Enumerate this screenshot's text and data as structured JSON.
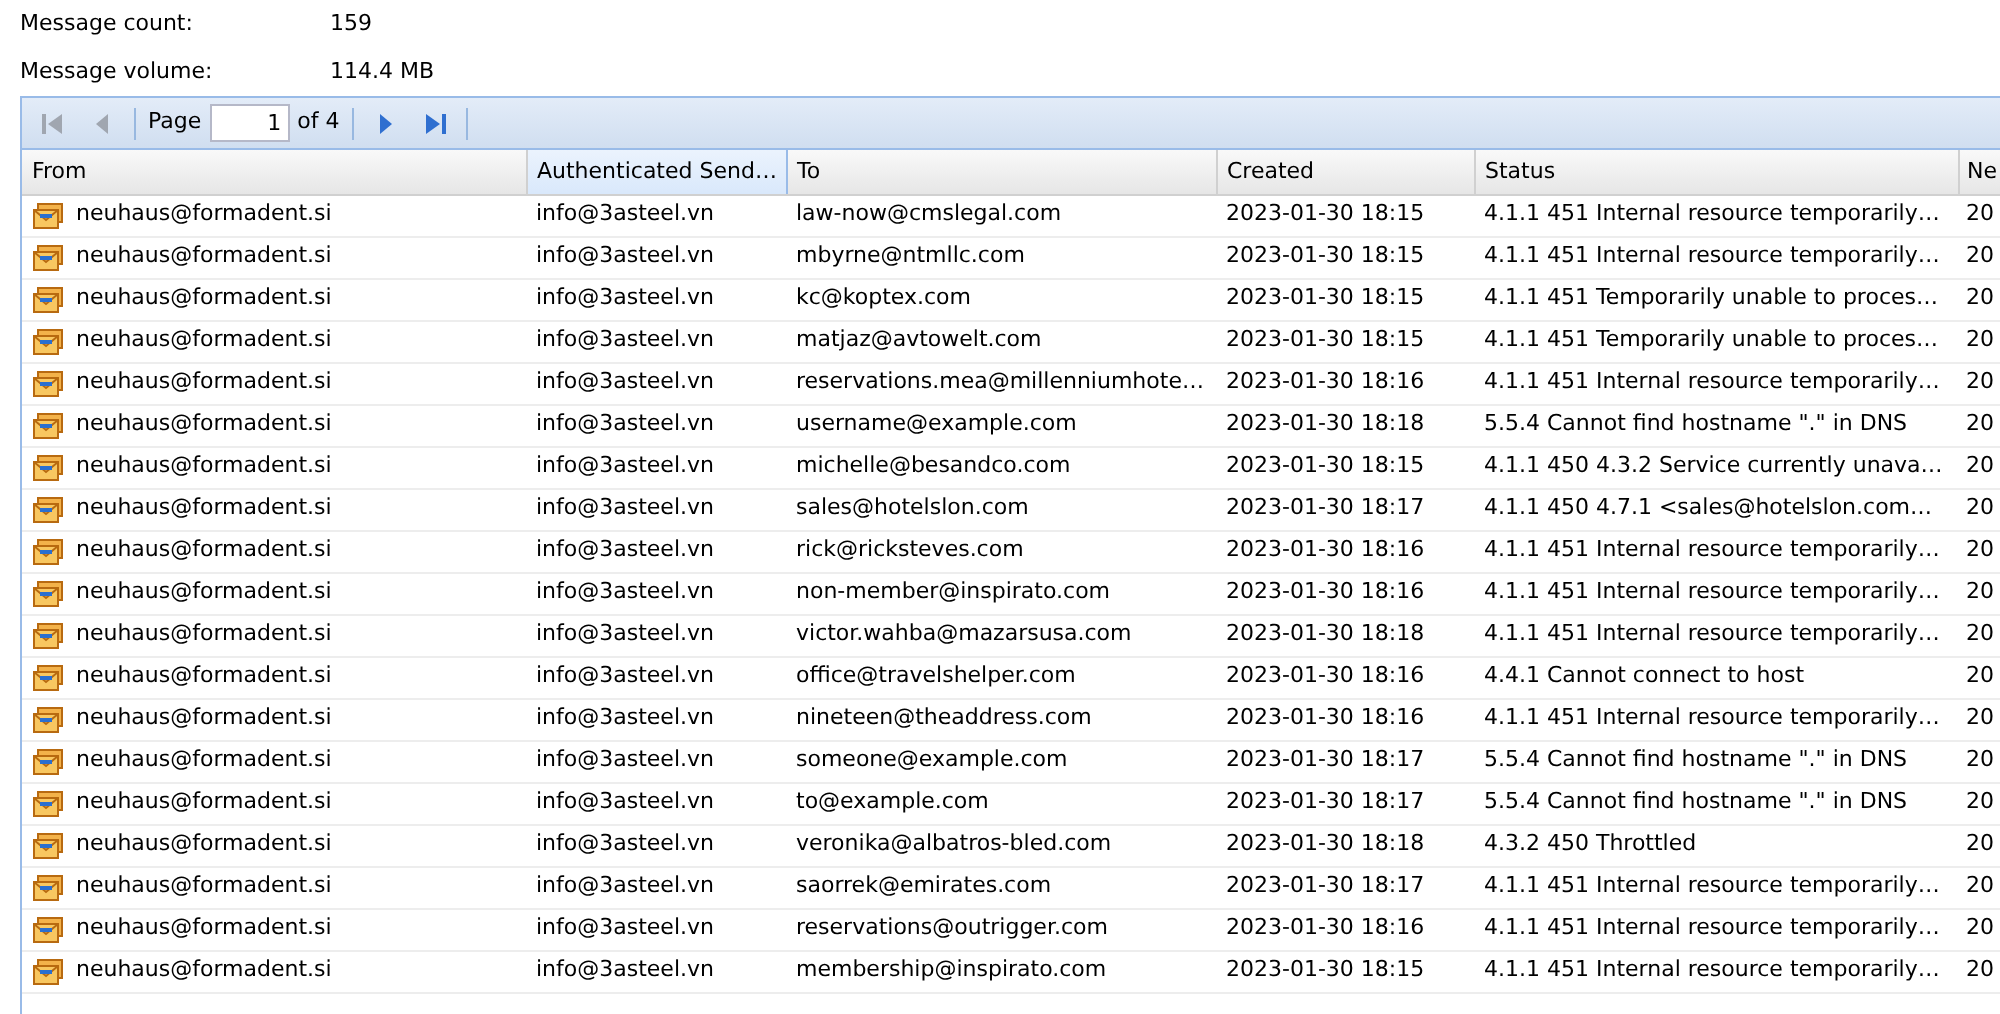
{
  "summary": [
    {
      "label": "Message count:",
      "value": "159"
    },
    {
      "label": "Message volume:",
      "value": "114.4 MB"
    }
  ],
  "pager": {
    "buttons": [
      {
        "kind": "first",
        "disabled": true
      },
      {
        "kind": "prev",
        "disabled": true
      }
    ],
    "page_label": "Page",
    "page_value": "1",
    "of_label": "of 4",
    "next_buttons": [
      {
        "kind": "next",
        "disabled": false
      },
      {
        "kind": "last",
        "disabled": false
      }
    ]
  },
  "table": {
    "columns": [
      {
        "label": "From",
        "active": false
      },
      {
        "label": "Authenticated Send…",
        "active": true
      },
      {
        "label": "To",
        "active": false
      },
      {
        "label": "Created",
        "active": false
      },
      {
        "label": "Status",
        "active": false
      },
      {
        "label": "Ne",
        "active": false
      }
    ],
    "rows": [
      [
        "neuhaus@formadent.si",
        "info@3asteel.vn",
        "law-now@cmslegal.com",
        "2023-01-30 18:15",
        "4.1.1 451 Internal resource temporarily…",
        "20"
      ],
      [
        "neuhaus@formadent.si",
        "info@3asteel.vn",
        "mbyrne@ntmllc.com",
        "2023-01-30 18:15",
        "4.1.1 451 Internal resource temporarily…",
        "20"
      ],
      [
        "neuhaus@formadent.si",
        "info@3asteel.vn",
        "kc@koptex.com",
        "2023-01-30 18:15",
        "4.1.1 451 Temporarily unable to proces…",
        "20"
      ],
      [
        "neuhaus@formadent.si",
        "info@3asteel.vn",
        "matjaz@avtowelt.com",
        "2023-01-30 18:15",
        "4.1.1 451 Temporarily unable to proces…",
        "20"
      ],
      [
        "neuhaus@formadent.si",
        "info@3asteel.vn",
        "reservations.mea@millenniumhote…",
        "2023-01-30 18:16",
        "4.1.1 451 Internal resource temporarily…",
        "20"
      ],
      [
        "neuhaus@formadent.si",
        "info@3asteel.vn",
        "username@example.com",
        "2023-01-30 18:18",
        "5.5.4 Cannot find hostname \".\" in DNS",
        "20"
      ],
      [
        "neuhaus@formadent.si",
        "info@3asteel.vn",
        "michelle@besandco.com",
        "2023-01-30 18:15",
        "4.1.1 450 4.3.2 Service currently unava…",
        "20"
      ],
      [
        "neuhaus@formadent.si",
        "info@3asteel.vn",
        "sales@hotelslon.com",
        "2023-01-30 18:17",
        "4.1.1 450 4.7.1 <sales@hotelslon.com…",
        "20"
      ],
      [
        "neuhaus@formadent.si",
        "info@3asteel.vn",
        "rick@ricksteves.com",
        "2023-01-30 18:16",
        "4.1.1 451 Internal resource temporarily…",
        "20"
      ],
      [
        "neuhaus@formadent.si",
        "info@3asteel.vn",
        "non-member@inspirato.com",
        "2023-01-30 18:16",
        "4.1.1 451 Internal resource temporarily…",
        "20"
      ],
      [
        "neuhaus@formadent.si",
        "info@3asteel.vn",
        "victor.wahba@mazarsusa.com",
        "2023-01-30 18:18",
        "4.1.1 451 Internal resource temporarily…",
        "20"
      ],
      [
        "neuhaus@formadent.si",
        "info@3asteel.vn",
        "office@travelshelper.com",
        "2023-01-30 18:16",
        "4.4.1 Cannot connect to host",
        "20"
      ],
      [
        "neuhaus@formadent.si",
        "info@3asteel.vn",
        "nineteen@theaddress.com",
        "2023-01-30 18:16",
        "4.1.1 451 Internal resource temporarily…",
        "20"
      ],
      [
        "neuhaus@formadent.si",
        "info@3asteel.vn",
        "someone@example.com",
        "2023-01-30 18:17",
        "5.5.4 Cannot find hostname \".\" in DNS",
        "20"
      ],
      [
        "neuhaus@formadent.si",
        "info@3asteel.vn",
        "to@example.com",
        "2023-01-30 18:17",
        "5.5.4 Cannot find hostname \".\" in DNS",
        "20"
      ],
      [
        "neuhaus@formadent.si",
        "info@3asteel.vn",
        "veronika@albatros-bled.com",
        "2023-01-30 18:18",
        "4.3.2 450 Throttled",
        "20"
      ],
      [
        "neuhaus@formadent.si",
        "info@3asteel.vn",
        "saorrek@emirates.com",
        "2023-01-30 18:17",
        "4.1.1 451 Internal resource temporarily…",
        "20"
      ],
      [
        "neuhaus@formadent.si",
        "info@3asteel.vn",
        "reservations@outrigger.com",
        "2023-01-30 18:16",
        "4.1.1 451 Internal resource temporarily…",
        "20"
      ],
      [
        "neuhaus@formadent.si",
        "info@3asteel.vn",
        "membership@inspirato.com",
        "2023-01-30 18:15",
        "4.1.1 451 Internal resource temporarily…",
        "20"
      ]
    ]
  }
}
